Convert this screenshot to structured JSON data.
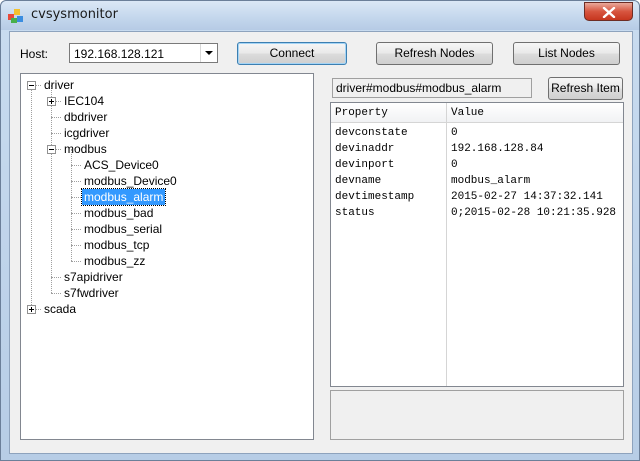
{
  "window": {
    "title": "cvsysmonitor",
    "icon": "cvsysmonitor-app-icon",
    "close_icon": "close-icon"
  },
  "toolbar": {
    "host_label": "Host:",
    "host_value": "192.168.128.121",
    "connect_label": "Connect",
    "refresh_nodes_label": "Refresh Nodes",
    "list_nodes_label": "List Nodes"
  },
  "tree": {
    "nodes": [
      {
        "label": "driver",
        "level": 0,
        "expander": "minus"
      },
      {
        "label": "IEC104",
        "level": 1,
        "expander": "plus"
      },
      {
        "label": "dbdriver",
        "level": 1,
        "expander": "none"
      },
      {
        "label": "icgdriver",
        "level": 1,
        "expander": "none"
      },
      {
        "label": "modbus",
        "level": 1,
        "expander": "minus"
      },
      {
        "label": "ACS_Device0",
        "level": 2,
        "expander": "none"
      },
      {
        "label": "modbus_Device0",
        "level": 2,
        "expander": "none"
      },
      {
        "label": "modbus_alarm",
        "level": 2,
        "expander": "none",
        "selected": true
      },
      {
        "label": "modbus_bad",
        "level": 2,
        "expander": "none"
      },
      {
        "label": "modbus_serial",
        "level": 2,
        "expander": "none"
      },
      {
        "label": "modbus_tcp",
        "level": 2,
        "expander": "none"
      },
      {
        "label": "modbus_zz",
        "level": 2,
        "expander": "none"
      },
      {
        "label": "s7apidriver",
        "level": 1,
        "expander": "none"
      },
      {
        "label": "s7fwdriver",
        "level": 1,
        "expander": "none"
      },
      {
        "label": "scada",
        "level": 0,
        "expander": "plus"
      }
    ]
  },
  "details": {
    "path": "driver#modbus#modbus_alarm",
    "refresh_item_label": "Refresh Item",
    "columns": [
      "Property",
      "Value"
    ],
    "rows": [
      {
        "property": "devconstate",
        "value": "0"
      },
      {
        "property": "devinaddr",
        "value": "192.168.128.84"
      },
      {
        "property": "devinport",
        "value": "0"
      },
      {
        "property": "devname",
        "value": "modbus_alarm"
      },
      {
        "property": "devtimestamp",
        "value": "2015-02-27 14:37:32.141"
      },
      {
        "property": "status",
        "value": "0;2015-02-28 10:21:35.928"
      }
    ]
  }
}
